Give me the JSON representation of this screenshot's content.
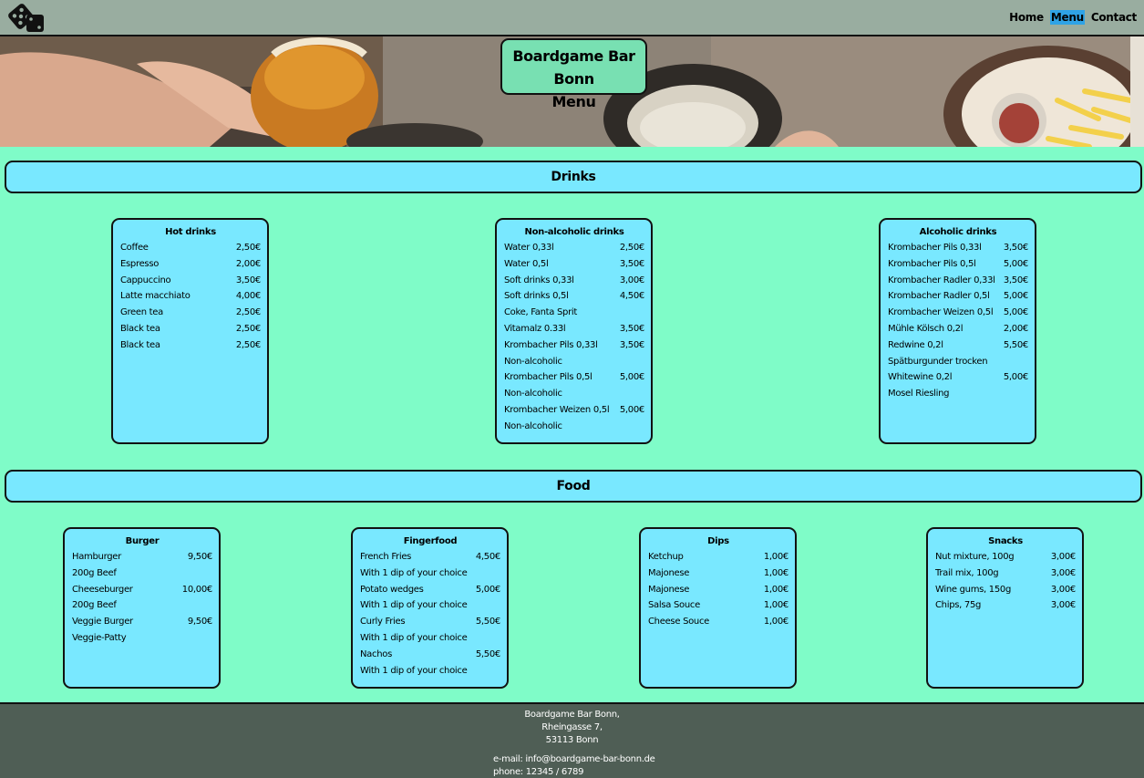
{
  "nav": {
    "links": [
      {
        "label": "Home"
      },
      {
        "label": "Menu"
      },
      {
        "label": "Contact"
      }
    ]
  },
  "hero": {
    "title_line1": "Boardgame Bar Bonn",
    "title_line2": "Menu"
  },
  "sections": {
    "drinks": "Drinks",
    "food": "Food"
  },
  "cards": {
    "hot": {
      "title": "Hot drinks",
      "items": [
        {
          "name": "Coffee",
          "price": "2,50€"
        },
        {
          "name": "Espresso",
          "price": "2,00€"
        },
        {
          "name": "Cappuccino",
          "price": "3,50€"
        },
        {
          "name": "Latte macchiato",
          "price": "4,00€"
        },
        {
          "name": "Green tea",
          "price": "2,50€"
        },
        {
          "name": "Black tea",
          "price": "2,50€"
        },
        {
          "name": "Black tea",
          "price": "2,50€"
        }
      ]
    },
    "nonalc": {
      "title": "Non-alcoholic drinks",
      "items": [
        {
          "name": "Water 0,33l",
          "price": "2,50€"
        },
        {
          "name": "Water 0,5l",
          "price": "3,50€"
        },
        {
          "name": "Soft drinks 0,33l",
          "price": "3,00€"
        },
        {
          "name": "Soft drinks 0,5l",
          "price": "4,50€"
        },
        {
          "name": "Coke, Fanta Sprit",
          "price": ""
        },
        {
          "name": "Vitamalz 0.33l",
          "price": "3,50€"
        },
        {
          "name": "Krombacher Pils 0,33l",
          "price": "3,50€"
        },
        {
          "name": "Non-alcoholic",
          "price": ""
        },
        {
          "name": "Krombacher Pils 0,5l",
          "price": "5,00€"
        },
        {
          "name": "Non-alcoholic",
          "price": ""
        },
        {
          "name": "Krombacher Weizen 0,5l",
          "price": "5,00€"
        },
        {
          "name": "Non-alcoholic",
          "price": ""
        }
      ]
    },
    "alc": {
      "title": "Alcoholic drinks",
      "items": [
        {
          "name": "Krombacher Pils 0,33l",
          "price": "3,50€"
        },
        {
          "name": "Krombacher Pils 0,5l",
          "price": "5,00€"
        },
        {
          "name": "Krombacher Radler 0,33l",
          "price": "3,50€"
        },
        {
          "name": "Krombacher Radler 0,5l",
          "price": "5,00€"
        },
        {
          "name": "Krombacher Weizen 0,5l",
          "price": "5,00€"
        },
        {
          "name": "Mühle Kölsch 0,2l",
          "price": "2,00€"
        },
        {
          "name": "Redwine 0,2l",
          "price": "5,50€"
        },
        {
          "name": "Spätburgunder trocken",
          "price": ""
        },
        {
          "name": "Whitewine 0,2l",
          "price": "5,00€"
        },
        {
          "name": "Mosel Riesling",
          "price": ""
        }
      ]
    },
    "burger": {
      "title": "Burger",
      "items": [
        {
          "name": "Hamburger",
          "price": "9,50€"
        },
        {
          "name": "200g Beef",
          "price": ""
        },
        {
          "name": "Cheeseburger",
          "price": "10,00€"
        },
        {
          "name": "200g Beef",
          "price": ""
        },
        {
          "name": "Veggie Burger",
          "price": "9,50€"
        },
        {
          "name": "Veggie-Patty",
          "price": ""
        }
      ]
    },
    "finger": {
      "title": "Fingerfood",
      "items": [
        {
          "name": "French Fries",
          "price": "4,50€"
        },
        {
          "name": "With 1 dip of your choice",
          "price": ""
        },
        {
          "name": "Potato wedges",
          "price": "5,00€"
        },
        {
          "name": "With 1 dip of your choice",
          "price": ""
        },
        {
          "name": "Curly Fries",
          "price": "5,50€"
        },
        {
          "name": "With 1 dip of your choice",
          "price": ""
        },
        {
          "name": "Nachos",
          "price": "5,50€"
        },
        {
          "name": "With 1 dip of your choice",
          "price": ""
        }
      ]
    },
    "dips": {
      "title": "Dips",
      "items": [
        {
          "name": "Ketchup",
          "price": "1,00€"
        },
        {
          "name": "Majonese",
          "price": "1,00€"
        },
        {
          "name": "Majonese",
          "price": "1,00€"
        },
        {
          "name": "Salsa Souce",
          "price": "1,00€"
        },
        {
          "name": "Cheese Souce",
          "price": "1,00€"
        }
      ]
    },
    "snacks": {
      "title": "Snacks",
      "items": [
        {
          "name": "Nut mixture, 100g",
          "price": "3,00€"
        },
        {
          "name": "Trail mix, 100g",
          "price": "3,00€"
        },
        {
          "name": "Wine gums, 150g",
          "price": "3,00€"
        },
        {
          "name": "Chips, 75g",
          "price": "3,00€"
        }
      ]
    }
  },
  "footer": {
    "address_line1": "Boardgame Bar Bonn,",
    "address_line2": "Rheingasse 7,",
    "address_line3": "53113 Bonn",
    "email": "e-mail: info@boardgame-bar-bonn.de",
    "phone": "phone: 12345 / 6789"
  },
  "colors": {
    "page_bg": "#7ffcc8",
    "nav_bg": "#99ada0",
    "card_bg": "#79e8ff",
    "active_link": "#2fa3e6",
    "footer_bg": "#4f5e55"
  },
  "icons": {
    "logo": "dice-icon"
  }
}
